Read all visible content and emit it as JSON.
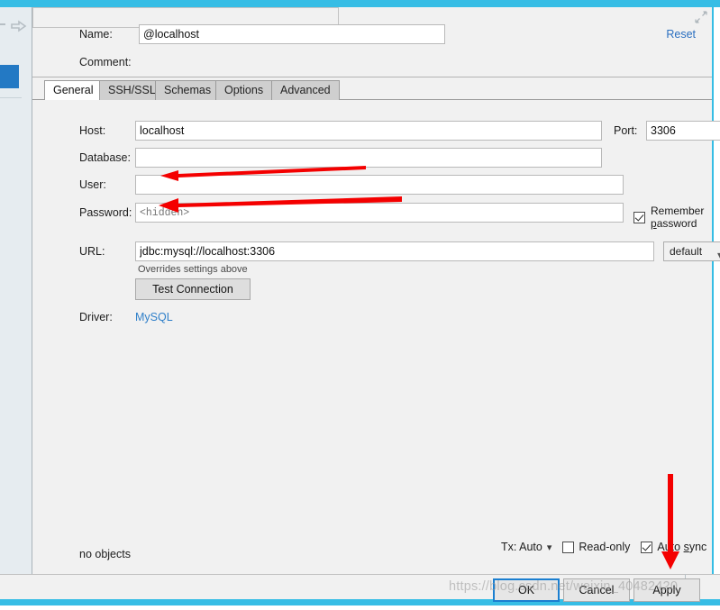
{
  "ide": {
    "left_panel": {
      "forward_icon": "right-arrow-icon",
      "selected_item": "selected-database-item"
    }
  },
  "dialog": {
    "header": {
      "name_label": "Name:",
      "name_value": "@localhost",
      "comment_label": "Comment:",
      "comment_value": "",
      "comment_expand_icon": "expand-diagonal-icon",
      "reset_label": "Reset"
    },
    "tabs": [
      {
        "label": "General",
        "active": true
      },
      {
        "label": "SSH/SSL",
        "active": false
      },
      {
        "label": "Schemas",
        "active": false
      },
      {
        "label": "Options",
        "active": false
      },
      {
        "label": "Advanced",
        "active": false
      }
    ],
    "general": {
      "host_label": "Host:",
      "host_value": "localhost",
      "port_label": "Port:",
      "port_value": "3306",
      "database_label": "Database:",
      "database_value": "",
      "user_label": "User:",
      "user_value": "",
      "password_label": "Password:",
      "password_placeholder": "<hidden>",
      "remember_password_label": "Remember password",
      "remember_password_checked": true,
      "url_label": "URL:",
      "url_value": "jdbc:mysql://localhost:3306",
      "url_note": "Overrides settings above",
      "driver_dropdown_value": "default",
      "test_connection_label": "Test Connection",
      "driver_label": "Driver:",
      "driver_value": "MySQL"
    },
    "status": {
      "objects_label": "no objects",
      "tx_label": "Tx: Auto",
      "read_only_label": "Read-only",
      "read_only_checked": false,
      "auto_sync_label": "Auto sync",
      "auto_sync_checked": true
    },
    "buttons": {
      "ok_label": "OK",
      "cancel_label": "Cancel",
      "apply_label": "Apply"
    }
  },
  "annotations": {
    "arrow_user": "red-arrow-pointing-to-user-field",
    "arrow_password": "red-arrow-pointing-to-password-field",
    "arrow_apply": "red-arrow-pointing-to-apply-button",
    "arrow_color": "#f40000"
  },
  "watermark": {
    "text": "https://blog.csdn.net/weixin_40482420"
  }
}
